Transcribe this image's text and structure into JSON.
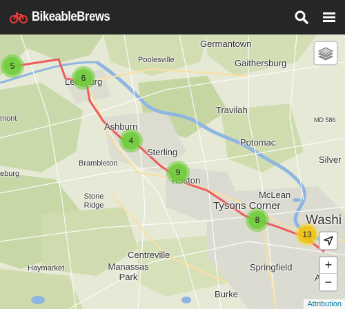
{
  "app": {
    "brand_name": "BikeableBrews",
    "brand_icon": "bicycle-icon",
    "accent": "#e83b3b",
    "actions": [
      {
        "name": "search",
        "icon": "search-icon"
      },
      {
        "name": "menu",
        "icon": "hamburger-menu-icon"
      }
    ]
  },
  "map": {
    "route_color": "#ee5a5a",
    "river_color": "#8fb6e0",
    "place_labels": [
      {
        "key": "germantown",
        "text": "Germantown"
      },
      {
        "key": "poolesville",
        "text": "Poolesville"
      },
      {
        "key": "gaithersburg",
        "text": "Gaithersburg"
      },
      {
        "key": "leesburg",
        "text": "Leesburg"
      },
      {
        "key": "travilah",
        "text": "Travilah"
      },
      {
        "key": "mont",
        "text": "mont"
      },
      {
        "key": "md586",
        "text": "MD 586"
      },
      {
        "key": "ashburn",
        "text": "Ashburn"
      },
      {
        "key": "potomac",
        "text": "Potomac"
      },
      {
        "key": "sterling",
        "text": "Sterling"
      },
      {
        "key": "brambleton",
        "text": "Brambleton"
      },
      {
        "key": "silver",
        "text": "Silver"
      },
      {
        "key": "eburg",
        "text": "eburg"
      },
      {
        "key": "reston",
        "text": "Reston"
      },
      {
        "key": "stoneridge",
        "text": "Stone Ridge"
      },
      {
        "key": "mclean",
        "text": "McLean"
      },
      {
        "key": "tysons",
        "text": "Tysons Corner"
      },
      {
        "key": "washi",
        "text": "Washi"
      },
      {
        "key": "centreville",
        "text": "Centreville"
      },
      {
        "key": "haymarket",
        "text": "Haymarket"
      },
      {
        "key": "manassas",
        "text": "Manassas Park"
      },
      {
        "key": "burke",
        "text": "Burke"
      },
      {
        "key": "springfield",
        "text": "Springfield"
      },
      {
        "key": "al",
        "text": "Al"
      }
    ],
    "clusters": [
      {
        "key": "c5",
        "count": "5",
        "color": "green"
      },
      {
        "key": "c6",
        "count": "6",
        "color": "green"
      },
      {
        "key": "c4",
        "count": "4",
        "color": "green"
      },
      {
        "key": "c9",
        "count": "9",
        "color": "green"
      },
      {
        "key": "c8",
        "count": "8",
        "color": "green"
      },
      {
        "key": "c13",
        "count": "13",
        "color": "yellow"
      }
    ],
    "controls": {
      "layers_icon": "layers-icon",
      "locate_icon": "locate-arrow-icon",
      "zoom_in": "+",
      "zoom_out": "−"
    },
    "attribution": "Attribution"
  }
}
